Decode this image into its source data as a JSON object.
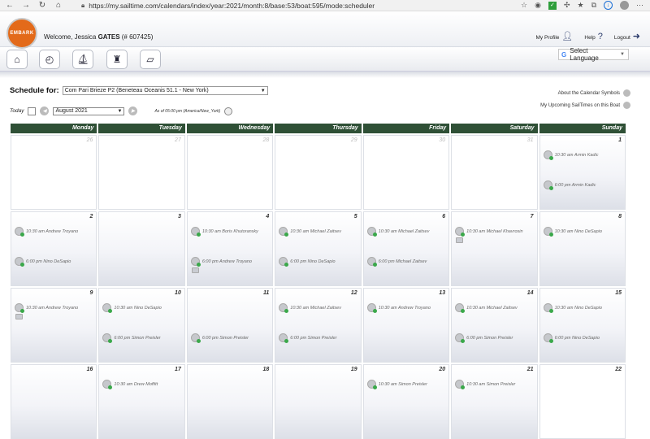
{
  "browser": {
    "url": "https://my.sailtime.com/calendars/index/year:2021/month:8/base:53/boat:595/mode:scheduler"
  },
  "header": {
    "logo_text": "EMBARK",
    "welcome_prefix": "Welcome, Jessica",
    "welcome_name": "GATES",
    "welcome_id": "(# 607425)",
    "my_profile": "My Profile",
    "help": "Help",
    "logout": "Logout"
  },
  "toolbar": {
    "language_label": "Select Language",
    "language_g": "G"
  },
  "schedule": {
    "label": "Schedule for:",
    "boat": "Com Pari Brieze P2 (Beneteau Oceanis 51.1 - New York)",
    "about_link": "About the Calendar Symbols",
    "upcoming_link": "My Upcoming SailTimes on this Boat",
    "today_label": "Today",
    "month": "August 2021",
    "as_of": "As of 05:00 pm (America/New_York)"
  },
  "calendar": {
    "weekdays": [
      "Monday",
      "Tuesday",
      "Wednesday",
      "Thursday",
      "Friday",
      "Saturday",
      "Sunday"
    ],
    "weeks": [
      [
        {
          "day": "26",
          "other": true,
          "bookings": []
        },
        {
          "day": "27",
          "other": true,
          "bookings": []
        },
        {
          "day": "28",
          "other": true,
          "bookings": []
        },
        {
          "day": "29",
          "other": true,
          "bookings": []
        },
        {
          "day": "30",
          "other": true,
          "bookings": []
        },
        {
          "day": "31",
          "other": true,
          "bookings": []
        },
        {
          "day": "1",
          "bookings": [
            "10:30 am Armin Kadic",
            "6:00 pm Armin Kadic"
          ]
        }
      ],
      [
        {
          "day": "2",
          "bookings": [
            "10:30 am Andrew Troyano",
            "6:00 pm Nino DeSapio"
          ]
        },
        {
          "day": "3",
          "bookings": []
        },
        {
          "day": "4",
          "bookings": [
            "10:30 am Boris Khutoransky",
            "6:00 pm Andrew Troyano"
          ],
          "extra": true
        },
        {
          "day": "5",
          "bookings": [
            "10:30 am Michael Zaitsev",
            "6:00 pm Nino DeSapio"
          ]
        },
        {
          "day": "6",
          "bookings": [
            "10:30 am Michael Zaitsev",
            "6:00 pm Michael Zaitsev"
          ]
        },
        {
          "day": "7",
          "bookings": [
            "10:30 am Michael Khavrosin"
          ],
          "extra": true
        },
        {
          "day": "8",
          "bookings": [
            "10:30 am Nino DeSapio"
          ]
        }
      ],
      [
        {
          "day": "9",
          "bookings": [
            "10:30 am Andrew Troyano"
          ],
          "extra": true
        },
        {
          "day": "10",
          "bookings": [
            "10:30 am Nino DeSapio",
            "6:00 pm Simon Preisler"
          ]
        },
        {
          "day": "11",
          "bookings": [
            "",
            "6:00 pm Simon Preisler"
          ]
        },
        {
          "day": "12",
          "bookings": [
            "10:30 am Michael Zaitsev",
            "6:00 pm Simon Preisler"
          ]
        },
        {
          "day": "13",
          "bookings": [
            "10:30 am Andrew Troyano"
          ]
        },
        {
          "day": "14",
          "bookings": [
            "10:30 am Michael Zaitsev",
            "6:00 pm Simon Preisler"
          ]
        },
        {
          "day": "15",
          "bookings": [
            "10:30 am Nino DeSapio",
            "6:00 pm Nino DeSapio"
          ]
        }
      ],
      [
        {
          "day": "16",
          "bookings": []
        },
        {
          "day": "17",
          "bookings": [
            "10:30 am Drew Moffitt"
          ]
        },
        {
          "day": "18",
          "bookings": []
        },
        {
          "day": "19",
          "bookings": []
        },
        {
          "day": "20",
          "bookings": [
            "10:30 am Simon Preisler"
          ]
        },
        {
          "day": "21",
          "bookings": [
            "10:30 am Simon Preisler"
          ]
        },
        {
          "day": "22",
          "bookings": [],
          "blank": true
        }
      ]
    ]
  }
}
